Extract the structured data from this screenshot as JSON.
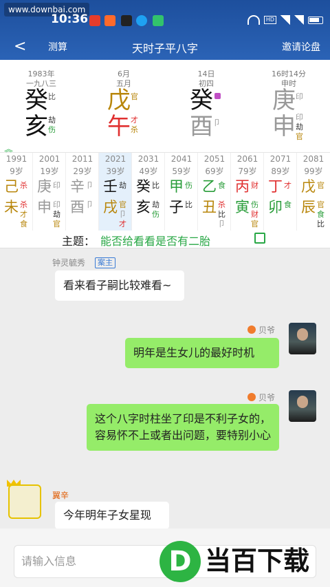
{
  "status": {
    "site": "www.downbai.com",
    "time": "10:36"
  },
  "nav": {
    "back": "<",
    "calc": "测算",
    "title": "天时子平八字",
    "invite": "邀请论盘"
  },
  "pillars": [
    {
      "d1": "1983年",
      "d2": "一九八三",
      "stem": "癸",
      "stem_color": "#111",
      "branch": "亥",
      "branch_color": "#111",
      "labels": {
        "s": "比",
        "b1": "劫",
        "b2": "伤"
      }
    },
    {
      "d1": "6月",
      "d2": "五月",
      "stem": "戊",
      "stem_color": "#b8860b",
      "branch": "午",
      "branch_color": "#e03030",
      "labels": {
        "s": "官",
        "b1": "才",
        "b2": "杀"
      }
    },
    {
      "d1": "14日",
      "d2": "初四",
      "stem": "癸",
      "stem_color": "#111",
      "branch": "酉",
      "branch_color": "#999",
      "labels": {
        "s": "",
        "b1": "卩",
        "b2": ""
      }
    },
    {
      "d1": "16时14分",
      "d2": "申时",
      "stem": "庚",
      "stem_color": "#999",
      "branch": "申",
      "branch_color": "#999",
      "labels": {
        "s": "印",
        "b1": "印",
        "b2": "劫",
        "b3": "官"
      }
    }
  ],
  "decades": [
    {
      "year": "1991",
      "age": "9岁",
      "stem": "己",
      "sc": "#b8860b",
      "branch": "未",
      "bc": "#b8860b",
      "t": [
        "杀",
        "",
        "杀",
        "才",
        "食"
      ]
    },
    {
      "year": "2001",
      "age": "19岁",
      "stem": "庚",
      "sc": "#999",
      "branch": "申",
      "bc": "#999",
      "t": [
        "印",
        "",
        "印",
        "劫",
        "官"
      ]
    },
    {
      "year": "2011",
      "age": "29岁",
      "stem": "辛",
      "sc": "#999",
      "branch": "酉",
      "bc": "#999",
      "t": [
        "卩",
        "",
        "卩",
        "",
        ""
      ]
    },
    {
      "year": "2021",
      "age": "39岁",
      "stem": "壬",
      "sc": "#111",
      "branch": "戌",
      "bc": "#b8860b",
      "t": [
        "劫",
        "",
        "官",
        "卩",
        "才"
      ]
    },
    {
      "year": "2031",
      "age": "49岁",
      "stem": "癸",
      "sc": "#111",
      "branch": "亥",
      "bc": "#111",
      "t": [
        "比",
        "",
        "劫",
        "伤",
        ""
      ]
    },
    {
      "year": "2041",
      "age": "59岁",
      "stem": "甲",
      "sc": "#2a9d3a",
      "branch": "子",
      "bc": "#111",
      "t": [
        "伤",
        "",
        "比",
        "",
        ""
      ]
    },
    {
      "year": "2051",
      "age": "69岁",
      "stem": "乙",
      "sc": "#2a9d3a",
      "branch": "丑",
      "bc": "#b8860b",
      "t": [
        "食",
        "",
        "杀",
        "比",
        "卩"
      ]
    },
    {
      "year": "2061",
      "age": "79岁",
      "stem": "丙",
      "sc": "#e03030",
      "branch": "寅",
      "bc": "#2a9d3a",
      "t": [
        "财",
        "",
        "伤",
        "财",
        "官"
      ]
    },
    {
      "year": "2071",
      "age": "89岁",
      "stem": "丁",
      "sc": "#e03030",
      "branch": "卯",
      "bc": "#2a9d3a",
      "t": [
        "才",
        "",
        "食",
        "",
        ""
      ]
    },
    {
      "year": "2081",
      "age": "99岁",
      "stem": "戊",
      "sc": "#b8860b",
      "branch": "辰",
      "bc": "#b8860b",
      "t": [
        "官",
        "",
        "官",
        "食",
        "比"
      ]
    }
  ],
  "topic": {
    "label": "主题：",
    "text": "能否给看看是否有二胎"
  },
  "chat": {
    "m1": {
      "name": "钟灵毓秀",
      "tag": "案主",
      "text": "看来看子嗣比较难看~"
    },
    "m2": {
      "name": "贝爷",
      "text": "明年是生女儿的最好时机"
    },
    "m3": {
      "name": "贝爷",
      "text": "这个八字时柱坐了印是不利子女的，容易怀不上或者出问题，要特别小心"
    },
    "m4": {
      "name": "翼辛",
      "text": "今年明年子女星现"
    }
  },
  "input": {
    "placeholder": "请输入信息"
  },
  "watermark": {
    "logo": "D",
    "text": "当百下载"
  }
}
